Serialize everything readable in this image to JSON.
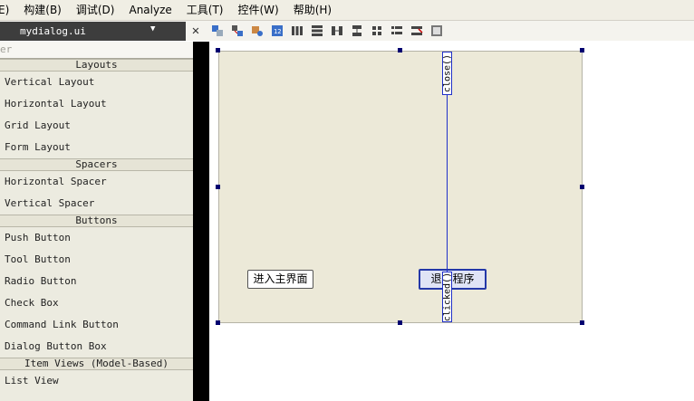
{
  "menubar": {
    "items": [
      "E)",
      "构建(B)",
      "调试(D)",
      "Analyze",
      "工具(T)",
      "控件(W)",
      "帮助(H)"
    ]
  },
  "toolbar": {
    "file_name": "mydialog.ui",
    "dropdown_glyph": "▼",
    "close_glyph": "✕",
    "tools": [
      "edit-widgets-icon",
      "edit-signals-icon",
      "edit-buddies-icon",
      "edit-tab-order-icon",
      "layout-horizontal-icon",
      "layout-vertical-icon",
      "layout-horizontal-splitter-icon",
      "layout-vertical-splitter-icon",
      "layout-grid-icon",
      "layout-form-icon",
      "break-layout-icon",
      "adjust-size-icon"
    ]
  },
  "widgetbox": {
    "filter_placeholder": "er",
    "categories": [
      {
        "title": "Layouts",
        "items": [
          "Vertical Layout",
          "Horizontal Layout",
          "Grid Layout",
          "Form Layout"
        ]
      },
      {
        "title": "Spacers",
        "items": [
          "Horizontal Spacer",
          "Vertical Spacer"
        ]
      },
      {
        "title": "Buttons",
        "items": [
          "Push Button",
          "Tool Button",
          "Radio Button",
          "Check Box",
          "Command Link Button",
          "Dialog Button Box"
        ]
      },
      {
        "title": "Item Views (Model-Based)",
        "items": [
          "List View"
        ]
      }
    ]
  },
  "form": {
    "enter_button": "进入主界面",
    "exit_button": "退出程序",
    "signal_label": "clicked()",
    "slot_label": "close()"
  },
  "colors": {
    "form_bg": "#ece9d8",
    "connection": "#2030c8",
    "handle": "#000070"
  }
}
